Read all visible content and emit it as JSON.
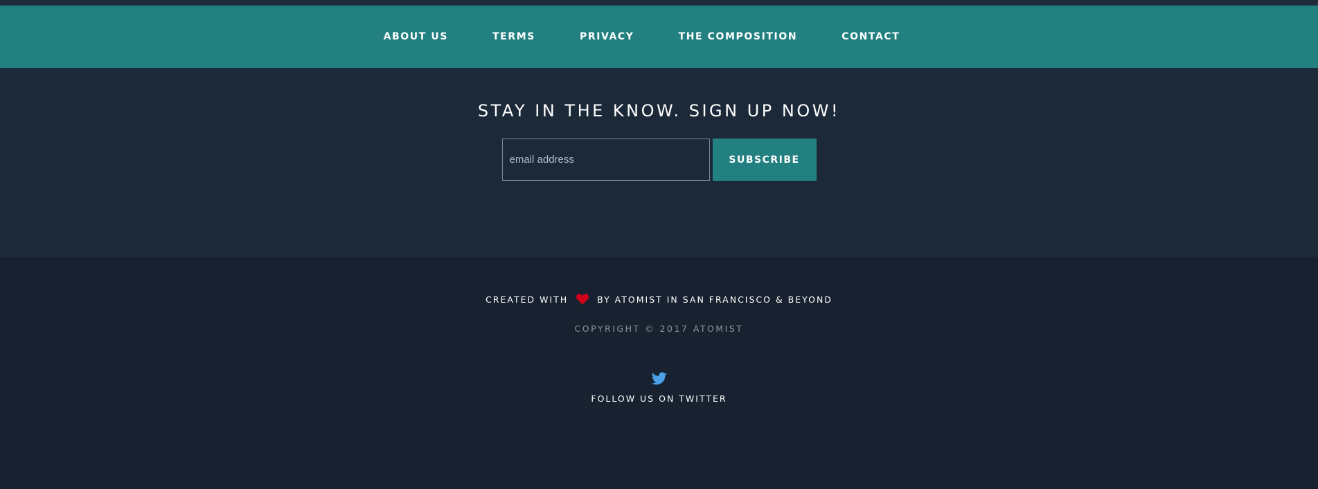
{
  "nav": {
    "items": [
      {
        "label": "ABOUT US"
      },
      {
        "label": "TERMS"
      },
      {
        "label": "PRIVACY"
      },
      {
        "label": "THE COMPOSITION"
      },
      {
        "label": "CONTACT"
      }
    ]
  },
  "signup": {
    "heading": "STAY IN THE KNOW. SIGN UP NOW!",
    "email_placeholder": "email address",
    "email_value": "",
    "subscribe_label": "SUBSCRIBE"
  },
  "footer": {
    "credit_before": "CREATED WITH",
    "credit_after": "BY ATOMIST IN SAN FRANCISCO & BEYOND",
    "copyright": "COPYRIGHT © 2017 ATOMIST",
    "follow_label": "FOLLOW US ON TWITTER"
  },
  "icons": {
    "heart": "heart-icon",
    "twitter": "twitter-icon"
  },
  "colors": {
    "accent": "#238080",
    "heart": "#d0021b",
    "twitter": "#4aa1e8",
    "signup_background": "#1c2938",
    "footer_background": "#17212f"
  }
}
